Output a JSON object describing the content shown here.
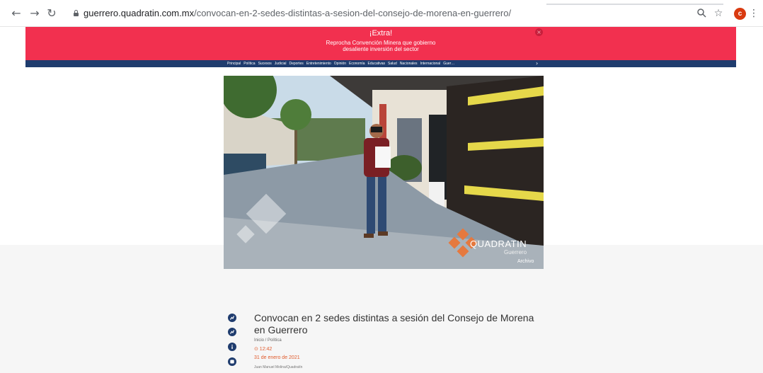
{
  "browser": {
    "url_host": "guerrero.quadratin.com.mx",
    "url_path": "/convocan-en-2-sedes-distintas-a-sesion-del-consejo-de-morena-en-guerrero/",
    "avatar_letter": "c",
    "icons": [
      "back-icon",
      "forward-icon",
      "reload-icon",
      "lock-icon",
      "zoom-icon",
      "star-icon",
      "menu-icon"
    ]
  },
  "extra": {
    "title": "¡Extra!",
    "line1": "Reprocha Convención Minera que gobierno",
    "line2": "desaliente inversión del sector",
    "close": "×"
  },
  "nav": {
    "items": [
      "Principal",
      "Política",
      "Sucesos",
      "Judicial",
      "Deportes",
      "Entretenimiento",
      "Opinión",
      "Economía",
      "Educativas",
      "Salud",
      "Nacionales",
      "Internacional",
      "Guer…"
    ],
    "next": "›"
  },
  "photo": {
    "brand": "QUADRATIN",
    "sub": "Guerrero",
    "caption": "Archivo"
  },
  "article": {
    "headline": "Convocan en 2 sedes distintas a sesión del Consejo de Morena en Guerrero",
    "breadcrumb": "Inicio / Política",
    "time": "⊙ 12:42",
    "date": "31 de enero de 2021",
    "author": "Juan Manuel Molina/Quadratín"
  },
  "colors": {
    "banner_red": "#f2304f",
    "nav_blue": "#1f3c6e",
    "accent_orange": "#e05a2b"
  }
}
